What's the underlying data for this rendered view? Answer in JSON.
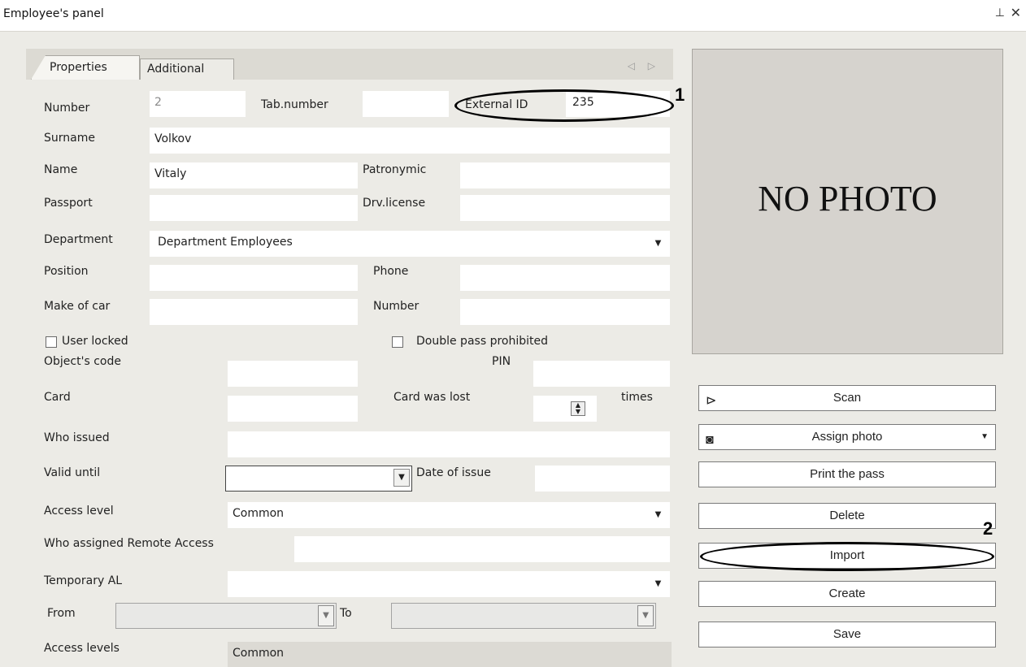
{
  "window": {
    "title": "Employee's panel",
    "pin_icon": "⊥",
    "close_icon": "✕"
  },
  "tabs": [
    {
      "label": "Properties"
    },
    {
      "label": "Additional"
    }
  ],
  "tab_scroll": "◁ ▷",
  "fields": {
    "number": {
      "label": "Number",
      "value": "2"
    },
    "tab_number": {
      "label": "Tab.number",
      "value": ""
    },
    "external_id": {
      "label": "External ID",
      "value": "235"
    },
    "surname": {
      "label": "Surname",
      "value": "Volkov"
    },
    "name": {
      "label": "Name",
      "value": "Vitaly"
    },
    "patronymic": {
      "label": "Patronymic",
      "value": ""
    },
    "passport": {
      "label": "Passport",
      "value": ""
    },
    "drv_license": {
      "label": "Drv.license",
      "value": ""
    },
    "department": {
      "label": "Department",
      "value": "Department Employees"
    },
    "position": {
      "label": "Position",
      "value": ""
    },
    "phone": {
      "label": "Phone",
      "value": ""
    },
    "make_of_car": {
      "label": "Make of car",
      "value": ""
    },
    "car_number": {
      "label": "Number",
      "value": ""
    },
    "user_locked": {
      "label": "User locked",
      "checked": false
    },
    "double_pass": {
      "label": "Double pass prohibited",
      "checked": false
    },
    "objects_code": {
      "label": "Object's code",
      "value": ""
    },
    "pin": {
      "label": "PIN",
      "value": ""
    },
    "card": {
      "label": "Card",
      "value": ""
    },
    "card_lost": {
      "label": "Card was lost",
      "value": "",
      "unit": "times"
    },
    "who_issued": {
      "label": "Who issued",
      "value": ""
    },
    "valid_until": {
      "label": "Valid until",
      "value": ""
    },
    "date_of_issue": {
      "label": "Date of issue",
      "value": ""
    },
    "access_level": {
      "label": "Access level",
      "value": "Common"
    },
    "remote_access": {
      "label": "Who assigned Remote Access",
      "value": ""
    },
    "temporary_al": {
      "label": "Temporary AL",
      "value": ""
    },
    "from": {
      "label": "From",
      "value": ""
    },
    "to": {
      "label": "To",
      "value": ""
    },
    "access_levels": {
      "label": "Access levels",
      "value": "Common"
    }
  },
  "photo": {
    "text": "NO PHOTO"
  },
  "buttons": {
    "scan": {
      "label": "Scan",
      "icon": "scanner-icon"
    },
    "assign_photo": {
      "label": "Assign photo",
      "icon": "camera-icon"
    },
    "print_pass": {
      "label": "Print the pass"
    },
    "delete": {
      "label": "Delete"
    },
    "import": {
      "label": "Import"
    },
    "create": {
      "label": "Create"
    },
    "save": {
      "label": "Save"
    }
  },
  "annotations": {
    "one": "1",
    "two": "2"
  }
}
